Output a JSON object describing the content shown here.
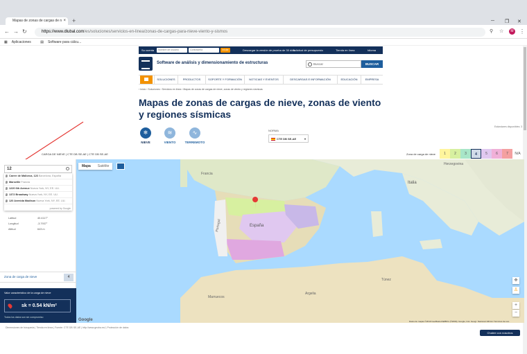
{
  "browser": {
    "tab_title": "Mapas de zonas de cargas de n",
    "tab_close": "×",
    "new_tab": "+",
    "url_host": "https://www.dlubal.com",
    "url_path": "/es/soluciones/servicios-en-linea/zonas-de-cargas-para-nieve-viento-y-sismos",
    "bookmarks": [
      "Aplicaciones",
      "Software para cálcu..."
    ],
    "avatar_letter": "M"
  },
  "topbar": {
    "account": "Su cuenta",
    "user_placeholder": "Nombre de usuario",
    "password_placeholder": "Contraseña",
    "login": "Iniciar",
    "download": "Descargar la versión de prueba de 30 días",
    "quote": "Solicitud de presupuesto",
    "shop": "Tienda en línea",
    "language": "Idioma"
  },
  "header": {
    "brand": "Software de análisis y dimensionamiento de estructuras",
    "search_placeholder": "Buscar",
    "search_button": "BUSCAR"
  },
  "menu": [
    "SOLUCIONES",
    "PRODUCTOS",
    "SOPORTE Y FORMACIÓN",
    "NOTICIAS Y EVENTOS",
    "DESCARGAS E INFORMACIÓN",
    "EDUCACIÓN",
    "EMPRESA"
  ],
  "breadcrumb": "›  Inicio  ›  Soluciones  ›  Servicios en línea  ›  Mapas de zonas de cargas de nieve, zonas de viento y regiones sísmicas",
  "page_title": "Mapas de zonas de cargas de nieve, zonas de viento y regiones sísmicas",
  "load_types": [
    {
      "label": "NIEVE",
      "icon": "snowflake-icon",
      "glyph": "❄",
      "color": "#1e5e9d"
    },
    {
      "label": "VIENTO",
      "icon": "wind-icon",
      "glyph": "≋",
      "color": "#8fb6dc"
    },
    {
      "label": "TERREMOTO",
      "icon": "earthquake-icon",
      "glyph": "∿",
      "color": "#8fb6dc"
    }
  ],
  "norma": {
    "label": "NORMA",
    "selected": "CTE DB SE-AE"
  },
  "standards_available": "Estándares disponibles: 3",
  "load_bar": {
    "text": "CARGA DE NIEVE  |  CTE DB SE-AE  |  CTE DB SE-AE"
  },
  "zones": {
    "label": "Zona de carga de nieve",
    "items": [
      {
        "n": "1",
        "color": "#fff59d"
      },
      {
        "n": "2",
        "color": "#d7f0a0"
      },
      {
        "n": "3",
        "color": "#a8e6c8"
      },
      {
        "n": "4",
        "color": "#d0dbe8"
      },
      {
        "n": "5",
        "color": "#e0c8f0"
      },
      {
        "n": "6",
        "color": "#f0b0d8"
      },
      {
        "n": "7",
        "color": "#f4a0a0"
      },
      {
        "n": "N/A",
        "color": "#ffffff"
      }
    ],
    "selected_index": 3
  },
  "search": {
    "value": "12",
    "suggestions": [
      {
        "main": "Carrer de Mallorca, 123",
        "sub": "Barcelona, España"
      },
      {
        "main": "Marseille",
        "sub": "Francia"
      },
      {
        "main": "1220 6th Avenue",
        "sub": "Nueva York, NY, EE. UU."
      },
      {
        "main": "1372 Broadway",
        "sub": "Nueva York, NY, EE. UU."
      },
      {
        "main": "120 Avenida Madison",
        "sub": "Nueva York, NY, EE. UU."
      }
    ],
    "powered_by": "powered by Google"
  },
  "location": [
    {
      "label": "Latitud",
      "value": "40.4117°"
    },
    {
      "label": "Longitud",
      "value": "-3.7937°"
    },
    {
      "label": "Altitud",
      "value": "643 m"
    }
  ],
  "zone_panel": {
    "title": "Zona de carga de nieve",
    "value": "4"
  },
  "characteristic": {
    "title": "Valor característico de la carga de nieve",
    "value": "sk = 0.54 kN/m²",
    "note": "Todos los datos son sin compromiso"
  },
  "map": {
    "buttons": [
      "Mapa",
      "Satélite"
    ],
    "labels": [
      {
        "t": "España",
        "big": true
      },
      {
        "t": "Portugal",
        "big": false
      },
      {
        "t": "Italia",
        "big": true
      },
      {
        "t": "Argelia",
        "big": false
      },
      {
        "t": "Túnez",
        "big": false
      },
      {
        "t": "Marruecos",
        "big": false
      },
      {
        "t": "Francia",
        "big": false
      },
      {
        "t": "Herzegovina",
        "big": false
      }
    ],
    "attribution": "Datos de mapas ©2019 GeoBasis-DE/BKG (©2009), Google, Inst. Geogr. Nacional   100 km   Términos de uso",
    "google": "Google"
  },
  "footer": "Dimensiones de búsqueda  |  Tienda en línea  |  Fuente: CTE DB SE-AE  |  http://www.geoba.es/  |  Protección de datos",
  "chat": "Chatee con nosotros"
}
